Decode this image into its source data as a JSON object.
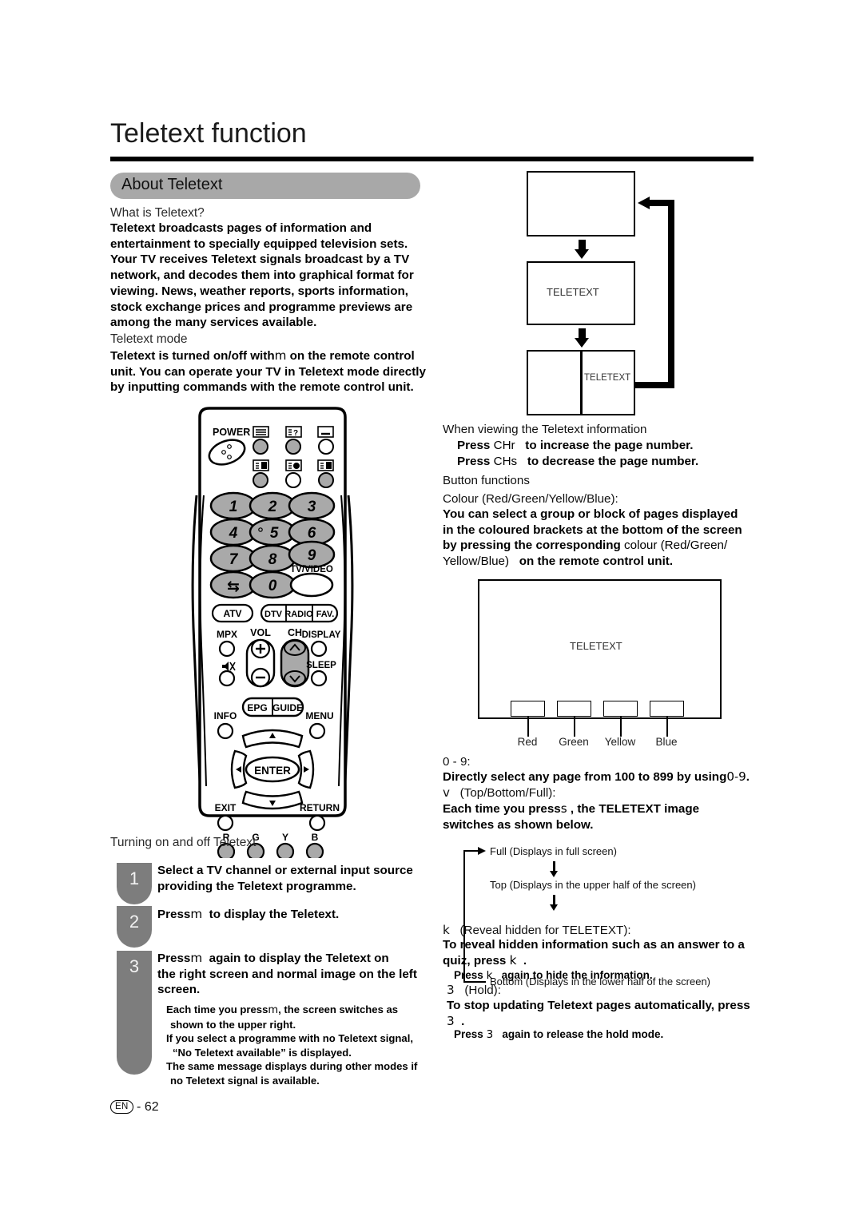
{
  "page": {
    "title": "Teletext function",
    "footer_locale": "EN",
    "footer_separator": "-",
    "footer_page_number": "62"
  },
  "section": {
    "pill_label": "About Teletext"
  },
  "what_is": {
    "heading": "What is Teletext?",
    "body": "Teletext broadcasts pages of information and entertainment to specially equipped television sets. Your TV receives Teletext signals broadcast by a TV network, and decodes them into graphical format for viewing. News, weather reports, sports information, stock exchange prices and programme previews are among the many services available.",
    "lines": [
      "Teletext broadcasts pages of information and",
      "entertainment to specially equipped television sets.",
      "Your TV receives Teletext signals broadcast by a TV",
      "network, and decodes them into graphical format for",
      "viewing. News, weather reports, sports information,",
      "stock exchange prices and programme previews are",
      "among the many services available."
    ]
  },
  "teletext_mode": {
    "heading": "Teletext mode",
    "line1_a": "Teletext is turned on/off with",
    "line1_glyph": "m",
    "line1_b": "on the remote control",
    "line2": "unit. You can operate your TV in Teletext mode directly",
    "line3": "by inputting commands with the remote control unit."
  },
  "remote": {
    "power_label": "POWER",
    "tvvideo_label": "TV/VIDEO",
    "numeric_keys": [
      "1",
      "2",
      "3",
      "4",
      "5",
      "6",
      "7",
      "8",
      "9",
      "0"
    ],
    "flashback_glyph": "⇆",
    "mode_buttons": [
      "ATV",
      "DTV",
      "RADIO",
      "FAV."
    ],
    "mpx_label": "MPX",
    "vol_label": "VOL",
    "ch_label": "CH",
    "display_label": "DISPLAY",
    "sleep_label": "SLEEP",
    "info_label": "INFO",
    "epg_label": "EPG",
    "guide_label": "GUIDE",
    "menu_label": "MENU",
    "enter_label": "ENTER",
    "exit_label": "EXIT",
    "return_label": "RETURN",
    "colour_keys": [
      "R",
      "G",
      "Y",
      "B"
    ],
    "vol_plus": "+",
    "vol_minus": "−"
  },
  "flow_diagram": {
    "box1_label": "",
    "box2_label": "TELETEXT",
    "box3_label": "TELETEXT"
  },
  "viewing_info": {
    "heading": "When viewing the Teletext information",
    "press_label": "Press",
    "ch_up_glyph": "CHr",
    "ch_up_text": "to increase the page number.",
    "ch_down_glyph": "CHs",
    "ch_down_text": "to decrease the page number."
  },
  "button_functions": {
    "heading": "Button functions",
    "colour_heading": "Colour (Red/Green/Yellow/Blue):",
    "line1": "You can select a group or block of pages displayed",
    "line2": "in the coloured  brackets at the bottom of the screen",
    "line3_a": "by pressing the corresponding",
    "line3_b": "colour (Red/Green/",
    "line4_a": "Yellow/Blue)",
    "line4_b": "on the remote control unit."
  },
  "colour_screen": {
    "screen_label": "TELETEXT",
    "bar_labels": [
      "Red",
      "Green",
      "Yellow",
      "Blue"
    ]
  },
  "numeric_select": {
    "heading": "0 - 9:",
    "line_a": "Directly select any page from 100 to 899 by using",
    "line_b": "0",
    "line_c": "-",
    "line_d": "9",
    "line_e": "."
  },
  "top_bottom_full": {
    "glyph": "v",
    "heading": "(Top/Bottom/Full):",
    "line1_a": "Each time you press",
    "line1_glyph": "s",
    "line1_b": ", the TELETEXT image",
    "line2": "switches as shown below."
  },
  "mode_flow": {
    "full": "Full (Displays in full screen)",
    "top": "Top (Displays in the upper half of the screen)",
    "bottom": "Bottom (Displays in the lower half of the screen)"
  },
  "reveal": {
    "glyph": "k",
    "heading": "(Reveal hidden for TELETEXT):",
    "line1": "To reveal hidden information such as an answer to a",
    "line2_a": "quiz",
    "line2_b": ", press",
    "line2_glyph": "k",
    "line2_c": ".",
    "note_a": "Press",
    "note_glyph": "k",
    "note_b": "again to hide the information."
  },
  "hold": {
    "glyph": "3",
    "heading": "(Hold):",
    "line1": "To  stop  updating  Teletext  pages  automatically,  press",
    "line2_glyph": "3",
    "line2_c": ".",
    "note_a": "Press",
    "note_glyph": "3",
    "note_b": "again to release the hold mode."
  },
  "turning_on_off": {
    "heading": "Turning on and off Teletext",
    "steps": [
      {
        "number": "1",
        "line1": "Select a TV channel or external input source",
        "line2": "providing the Teletext programme."
      },
      {
        "number": "2",
        "line1_a": "Press",
        "line1_glyph": "m",
        "line1_b": "to display the Teletext."
      },
      {
        "number": "3",
        "line1_a": "Press",
        "line1_glyph": "m",
        "line1_b": "again to display the Teletext on",
        "line2": "the right screen and normal image on the left",
        "line3": "screen."
      }
    ],
    "notes": [
      {
        "a": "Each time you press",
        "glyph": "m",
        "b": ", the screen switches as",
        "c": "shown to the upper right."
      },
      {
        "a": "If you select a programme with no Teletext signal,",
        "b": "“No Teletext available” is displayed."
      },
      {
        "a": "The same message displays during other modes if",
        "b": "no Teletext signal is available."
      }
    ]
  }
}
